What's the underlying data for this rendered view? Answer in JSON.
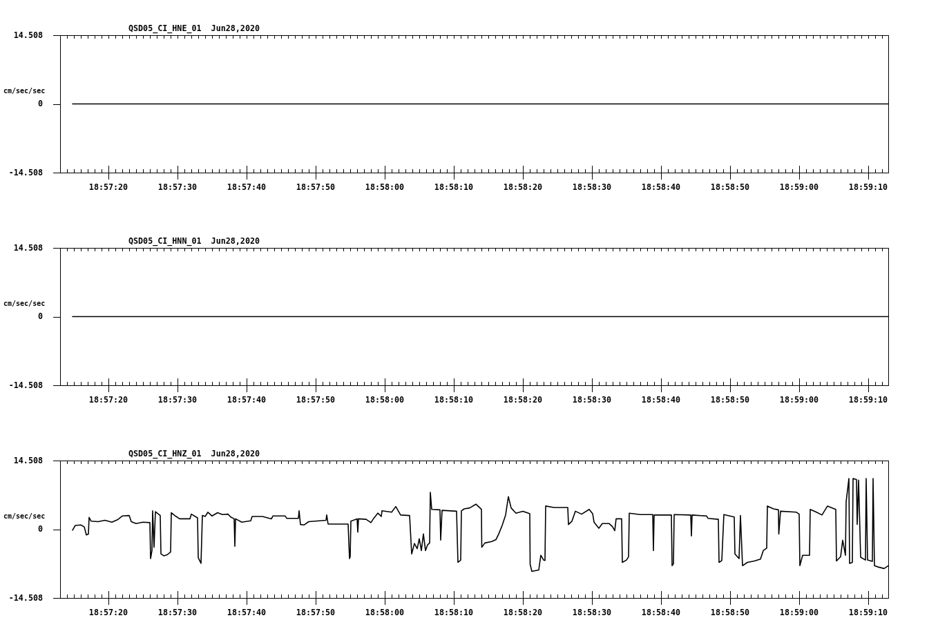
{
  "panels": [
    {
      "chart_data": {
        "type": "line",
        "title": "QSD05_CI_HNE_01  Jun28,2020",
        "ylabel": "cm/sec/sec",
        "x": [
          68234.8,
          68352.9
        ],
        "series": [
          {
            "color": "#000000",
            "values": [
              0,
              0
            ]
          }
        ],
        "xlim": [
          68233,
          68352.9
        ],
        "ylim": [
          -14.508,
          14.508
        ],
        "xticks": [
          {
            "value": 68240,
            "label": "18:57:20"
          },
          {
            "value": 68250,
            "label": "18:57:30"
          },
          {
            "value": 68260,
            "label": "18:57:40"
          },
          {
            "value": 68270,
            "label": "18:57:50"
          },
          {
            "value": 68280,
            "label": "18:58:00"
          },
          {
            "value": 68290,
            "label": "18:58:10"
          },
          {
            "value": 68300,
            "label": "18:58:20"
          },
          {
            "value": 68310,
            "label": "18:58:30"
          },
          {
            "value": 68320,
            "label": "18:58:40"
          },
          {
            "value": 68330,
            "label": "18:58:50"
          },
          {
            "value": 68340,
            "label": "18:59:00"
          },
          {
            "value": 68350,
            "label": "18:59:10"
          }
        ],
        "yticks": [
          14.508,
          0,
          -14.508
        ]
      }
    },
    {
      "chart_data": {
        "type": "line",
        "title": "QSD05_CI_HNN_01  Jun28,2020",
        "ylabel": "cm/sec/sec",
        "x": [
          68234.8,
          68352.9
        ],
        "series": [
          {
            "color": "#000000",
            "values": [
              0,
              0
            ]
          }
        ],
        "xlim": [
          68233,
          68352.9
        ],
        "ylim": [
          -14.508,
          14.508
        ],
        "xticks": [
          {
            "value": 68240,
            "label": "18:57:20"
          },
          {
            "value": 68250,
            "label": "18:57:30"
          },
          {
            "value": 68260,
            "label": "18:57:40"
          },
          {
            "value": 68270,
            "label": "18:57:50"
          },
          {
            "value": 68280,
            "label": "18:58:00"
          },
          {
            "value": 68290,
            "label": "18:58:10"
          },
          {
            "value": 68300,
            "label": "18:58:20"
          },
          {
            "value": 68310,
            "label": "18:58:30"
          },
          {
            "value": 68320,
            "label": "18:58:40"
          },
          {
            "value": 68330,
            "label": "18:58:50"
          },
          {
            "value": 68340,
            "label": "18:59:00"
          },
          {
            "value": 68350,
            "label": "18:59:10"
          }
        ],
        "yticks": [
          14.508,
          0,
          -14.508
        ]
      }
    },
    {
      "chart_data": {
        "type": "line",
        "title": "QSD05_CI_HNZ_01  Jun28,2020",
        "ylabel": "cm/sec/sec",
        "x": [
          68234.8,
          68235.2,
          68236,
          68236.5,
          68236.8,
          68237.1,
          68237.2,
          68237.5,
          68238.5,
          68239.5,
          68240.5,
          68241.3,
          68242,
          68243,
          68243.3,
          68244,
          68245,
          68246,
          68246.1,
          68246.3,
          68246.4,
          68246.6,
          68246.8,
          68247.5,
          68247.6,
          68248,
          68248.5,
          68249,
          68249.1,
          68249.6,
          68250.3,
          68251.8,
          68252,
          68252.9,
          68253,
          68253.4,
          68253.6,
          68254,
          68254.4,
          68255,
          68255.8,
          68256.5,
          68257.3,
          68257.7,
          68258.2,
          68258.3,
          68258.4,
          68259.3,
          68260.6,
          68260.8,
          68262.3,
          68263.6,
          68263.8,
          68265.6,
          68265.8,
          68267.5,
          68267.6,
          68267.8,
          68268.3,
          68269,
          68271.5,
          68271.6,
          68271.8,
          68274.7,
          68274.9,
          68275,
          68275.1,
          68276,
          68276.1,
          68276.2,
          68277.3,
          68278,
          68278.5,
          68279,
          68279.5,
          68279.6,
          68281,
          68281.6,
          68282.3,
          68283.6,
          68283.9,
          68284.3,
          68284.7,
          68285,
          68285.3,
          68285.6,
          68285.9,
          68286.2,
          68286.5,
          68286.6,
          68286.8,
          68288,
          68288.1,
          68288.3,
          68290.4,
          68290.6,
          68291,
          68291.1,
          68291.5,
          68292.3,
          68293.2,
          68294,
          68294.05,
          68294.5,
          68295.5,
          68296.1,
          68296.5,
          68297,
          68297.5,
          68297.9,
          68298.3,
          68299,
          68300,
          68301,
          68301.05,
          68301.3,
          68302.3,
          68302.6,
          68303,
          68303.2,
          68303.3,
          68304.5,
          68306.5,
          68306.6,
          68307.1,
          68307.6,
          68308.5,
          68309.6,
          68310.1,
          68310.3,
          68311,
          68311.5,
          68312.5,
          68313,
          68313.3,
          68313.5,
          68314.3,
          68314.4,
          68315,
          68315.3,
          68315.4,
          68317,
          68318.8,
          68318.9,
          68319,
          68321.5,
          68321.6,
          68321.8,
          68321.9,
          68324.3,
          68324.4,
          68324.5,
          68326.6,
          68326.8,
          68328.3,
          68328.4,
          68328.8,
          68329.1,
          68330.6,
          68330.7,
          68331.3,
          68331.5,
          68331.8,
          68332.5,
          68333.5,
          68334.4,
          68334.8,
          68335.3,
          68335.4,
          68336.3,
          68337,
          68337.05,
          68337.3,
          68339.6,
          68340,
          68340.1,
          68340.5,
          68341.5,
          68341.6,
          68342.5,
          68343.3,
          68344.1,
          68345.3,
          68345.4,
          68346,
          68346.3,
          68346.7,
          68346.8,
          68347.2,
          68347.3,
          68347.7,
          68347.8,
          68348.3,
          68348.4,
          68348.6,
          68348.9,
          68349.6,
          68349.7,
          68349.9,
          68350.6,
          68350.7,
          68350.9,
          68351.5,
          68352.3,
          68352.9
        ],
        "series": [
          {
            "color": "#000000",
            "values": [
              -0.2,
              0.8,
              0.9,
              0.5,
              -1.2,
              -1.0,
              2.5,
              1.7,
              1.6,
              1.9,
              1.5,
              2.0,
              2.8,
              2.9,
              1.6,
              1.2,
              1.5,
              1.4,
              -6.2,
              -4.5,
              3.9,
              -3.8,
              3.7,
              2.9,
              -5.2,
              -5.6,
              -5.4,
              -4.8,
              3.5,
              2.9,
              2.2,
              2.2,
              3.2,
              2.4,
              -6.0,
              -7.2,
              2.9,
              2.7,
              3.6,
              2.8,
              3.5,
              3.1,
              3.2,
              2.6,
              2.2,
              -3.6,
              2.2,
              1.5,
              1.8,
              2.7,
              2.7,
              2.2,
              2.8,
              2.8,
              2.3,
              2.3,
              3.9,
              1.0,
              0.9,
              1.6,
              1.9,
              3.0,
              1.1,
              1.1,
              -6.2,
              -5.8,
              1.7,
              2.2,
              -0.6,
              2.2,
              2.1,
              1.4,
              2.5,
              3.4,
              2.7,
              3.9,
              3.6,
              4.8,
              3.0,
              2.9,
              -5.2,
              -3.0,
              -4.1,
              -2.0,
              -4.5,
              -1.0,
              -4.5,
              -3.3,
              -2.9,
              7.8,
              4.2,
              4.1,
              -2.3,
              4.0,
              3.8,
              -7.0,
              -6.5,
              3.9,
              4.3,
              4.5,
              5.3,
              4.2,
              -3.8,
              -2.9,
              -2.6,
              -2.2,
              -1.0,
              0.8,
              3.0,
              6.9,
              4.5,
              3.4,
              3.8,
              3.3,
              -7.4,
              -8.9,
              -8.6,
              -5.5,
              -6.5,
              -6.6,
              4.9,
              4.6,
              4.6,
              1.0,
              1.7,
              3.8,
              3.2,
              4.2,
              3.3,
              1.5,
              0.2,
              1.2,
              1.2,
              0.5,
              -0.3,
              2.2,
              2.2,
              -7.0,
              -6.5,
              -5.8,
              3.4,
              3.1,
              3.1,
              -4.5,
              3.0,
              3.0,
              -7.7,
              -7.3,
              3.1,
              3.0,
              -1.4,
              3.0,
              2.8,
              2.3,
              2.1,
              -7.0,
              -6.6,
              3.1,
              2.6,
              -5.2,
              -6.2,
              2.9,
              -7.7,
              -7.0,
              -6.7,
              -6.3,
              -4.5,
              -4.0,
              4.9,
              4.3,
              4.1,
              -1.0,
              3.8,
              3.6,
              3.2,
              -7.7,
              -5.5,
              -5.5,
              4.2,
              3.6,
              3.0,
              4.9,
              4.2,
              -6.7,
              -5.8,
              -2.3,
              -5.5,
              5.8,
              10.7,
              -7.2,
              -7.0,
              10.7,
              10.5,
              1.0,
              10.4,
              -5.9,
              -6.5,
              10.7,
              -6.5,
              -6.8,
              10.7,
              -7.7,
              -8.0,
              -8.3,
              -7.7
            ]
          }
        ],
        "xlim": [
          68233,
          68352.9
        ],
        "ylim": [
          -14.508,
          14.508
        ],
        "xticks": [
          {
            "value": 68240,
            "label": "18:57:20"
          },
          {
            "value": 68250,
            "label": "18:57:30"
          },
          {
            "value": 68260,
            "label": "18:57:40"
          },
          {
            "value": 68270,
            "label": "18:57:50"
          },
          {
            "value": 68280,
            "label": "18:58:00"
          },
          {
            "value": 68290,
            "label": "18:58:10"
          },
          {
            "value": 68300,
            "label": "18:58:20"
          },
          {
            "value": 68310,
            "label": "18:58:30"
          },
          {
            "value": 68320,
            "label": "18:58:40"
          },
          {
            "value": 68330,
            "label": "18:58:50"
          },
          {
            "value": 68340,
            "label": "18:59:00"
          },
          {
            "value": 68350,
            "label": "18:59:10"
          }
        ],
        "yticks": [
          14.508,
          0,
          -14.508
        ]
      }
    }
  ]
}
